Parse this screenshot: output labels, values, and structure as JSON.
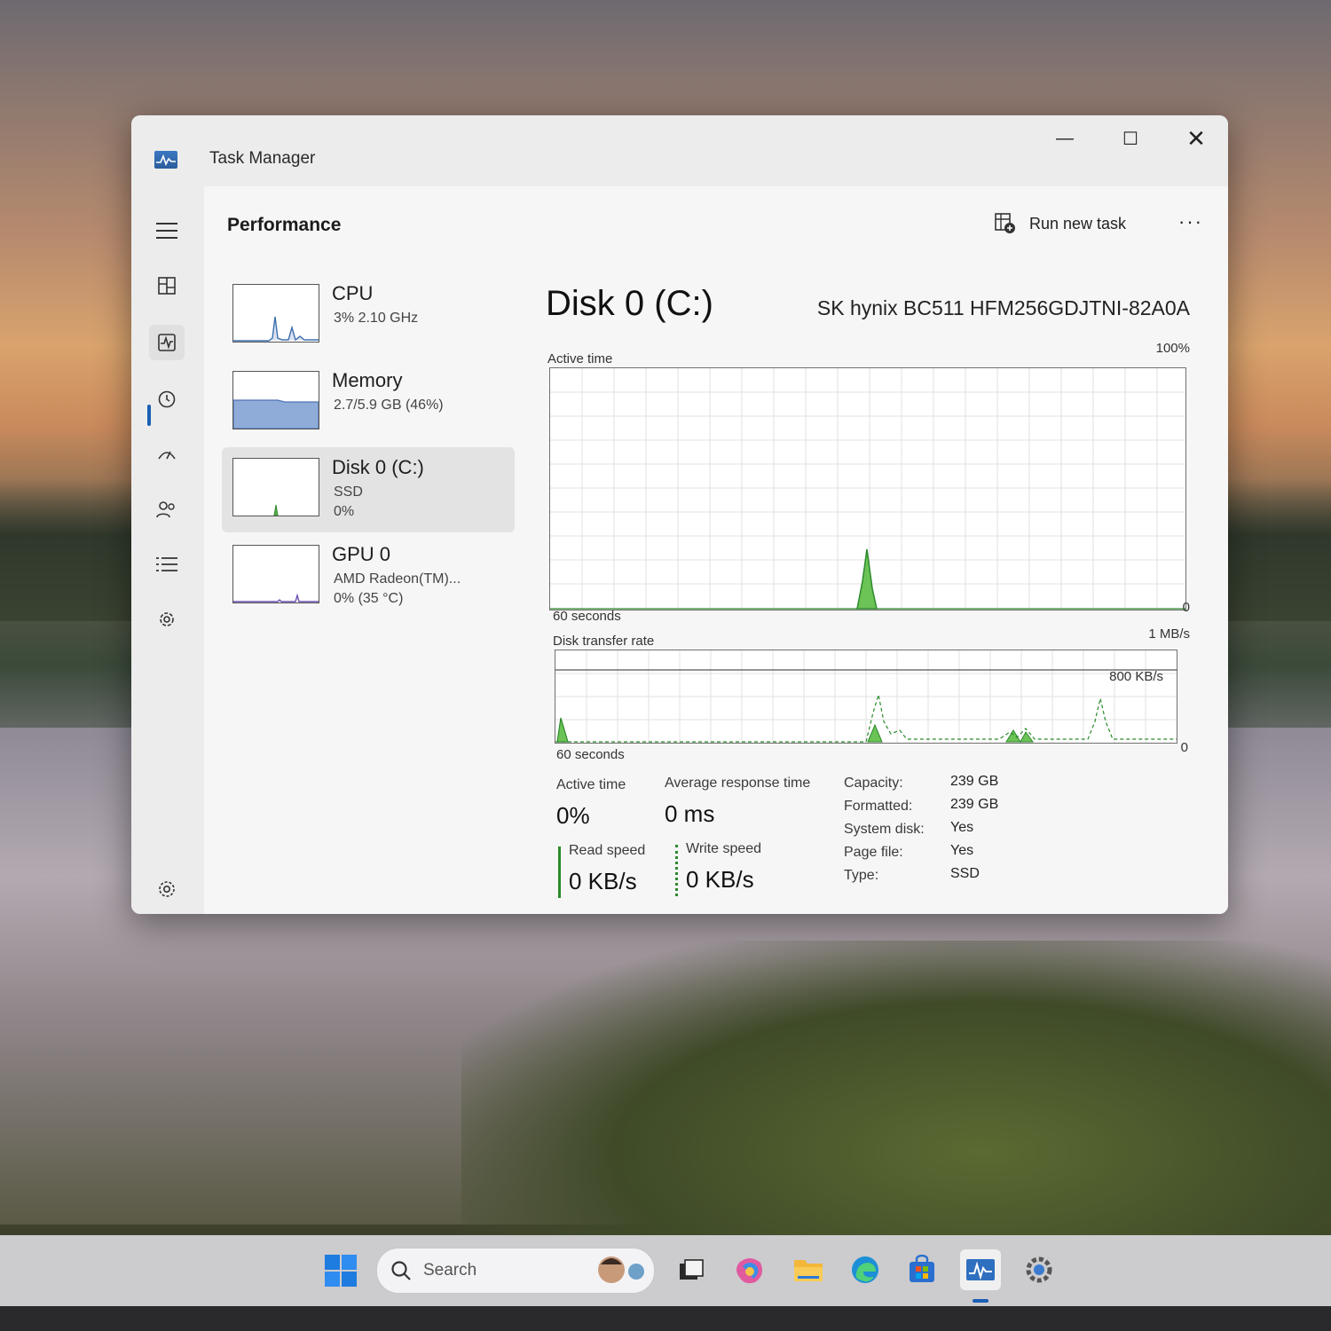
{
  "window": {
    "title": "Task Manager",
    "controls": {
      "minimize": "—",
      "maximize": "☐",
      "close": "✕"
    }
  },
  "header": {
    "page_title": "Performance",
    "run_new_task": "Run new task",
    "more": "···"
  },
  "nav": {
    "items": [
      "menu-icon",
      "processes-icon",
      "performance-icon",
      "app-history-icon",
      "startup-apps-icon",
      "users-icon",
      "details-icon",
      "services-icon",
      "settings-icon"
    ],
    "active": "performance-icon"
  },
  "resources": [
    {
      "name": "CPU",
      "sub1": "3%  2.10 GHz",
      "sub2": ""
    },
    {
      "name": "Memory",
      "sub1": "2.7/5.9 GB (46%)",
      "sub2": ""
    },
    {
      "name": "Disk 0 (C:)",
      "sub1": "SSD",
      "sub2": "0%"
    },
    {
      "name": "GPU 0",
      "sub1": "AMD Radeon(TM)...",
      "sub2": "0%  (35 °C)"
    }
  ],
  "detail": {
    "title": "Disk 0 (C:)",
    "model": "SK hynix BC511 HFM256GDJTNI-82A0A",
    "active_time_graph": {
      "label": "Active time",
      "max": "100%",
      "min": "0",
      "duration": "60 seconds"
    },
    "transfer_graph": {
      "label": "Disk transfer rate",
      "max": "1 MB/s",
      "mid": "800 KB/s",
      "min": "0",
      "duration": "60 seconds"
    },
    "stats": {
      "active_time_label": "Active time",
      "active_time_value": "0%",
      "avg_response_label": "Average response time",
      "avg_response_value": "0 ms",
      "read_label": "Read speed",
      "read_value": "0 KB/s",
      "write_label": "Write speed",
      "write_value": "0 KB/s"
    },
    "properties": [
      {
        "key": "Capacity:",
        "value": "239 GB"
      },
      {
        "key": "Formatted:",
        "value": "239 GB"
      },
      {
        "key": "System disk:",
        "value": "Yes"
      },
      {
        "key": "Page file:",
        "value": "Yes"
      },
      {
        "key": "Type:",
        "value": "SSD"
      }
    ]
  },
  "taskbar": {
    "search_placeholder": "Search",
    "icons": [
      "start-icon",
      "task-view-icon",
      "copilot-icon",
      "file-explorer-icon",
      "edge-icon",
      "store-icon",
      "task-manager-icon",
      "settings-icon"
    ]
  },
  "colors": {
    "accent": "#1a5fb4",
    "disk_graph": "#2c8a2c",
    "memory_graph": "#7a9ed6",
    "cpu_graph": "#3d6fb0"
  }
}
